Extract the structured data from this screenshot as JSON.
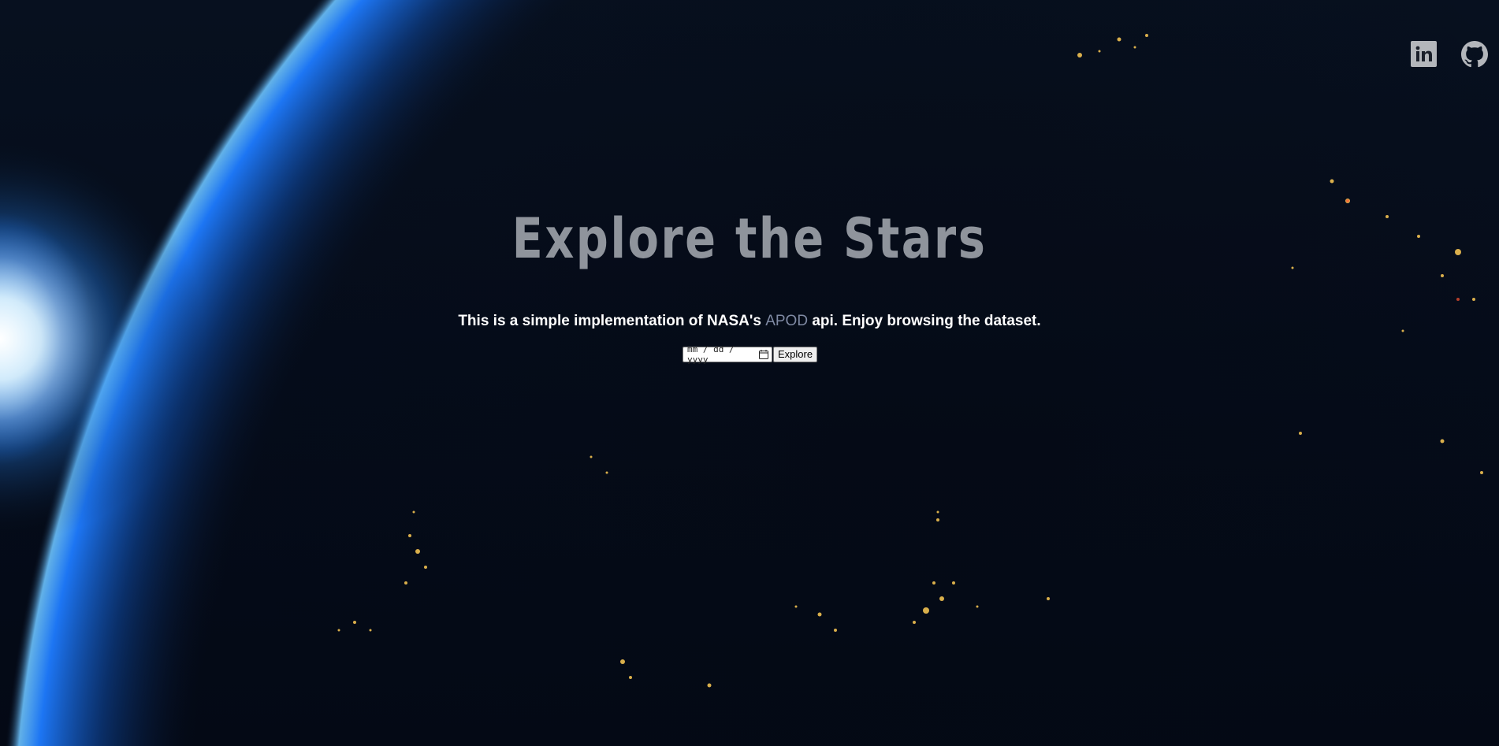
{
  "hero": {
    "title": "Explore the Stars",
    "subtitle_before": "This is a simple implementation of NASA's ",
    "subtitle_link": "APOD",
    "subtitle_after": " api. Enjoy browsing the dataset."
  },
  "search": {
    "date_placeholder": "mm / dd / yyyy",
    "button_label": "Explore"
  },
  "social": {
    "icons": [
      "linkedin-icon",
      "github-icon"
    ]
  },
  "colors": {
    "title": "#8f949c",
    "link": "#7f8aa3",
    "background": "#050b18",
    "earth_atmosphere": "#1e7bff"
  }
}
